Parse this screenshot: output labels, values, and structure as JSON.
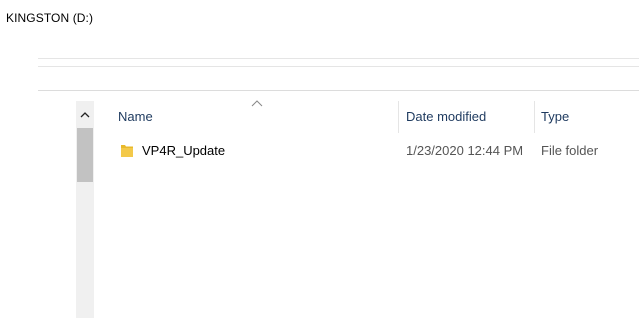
{
  "window": {
    "title": "KINGSTON (D:)"
  },
  "columns": {
    "name": "Name",
    "date_modified": "Date modified",
    "type": "Type"
  },
  "files": [
    {
      "name": "VP4R_Update",
      "date_modified": "1/23/2020 12:44 PM",
      "type": "File folder",
      "icon": "folder-icon"
    }
  ],
  "colors": {
    "folder": "#e8b92b",
    "header_text": "#1e3a5f",
    "scroll_thumb": "#c2c2c2"
  }
}
